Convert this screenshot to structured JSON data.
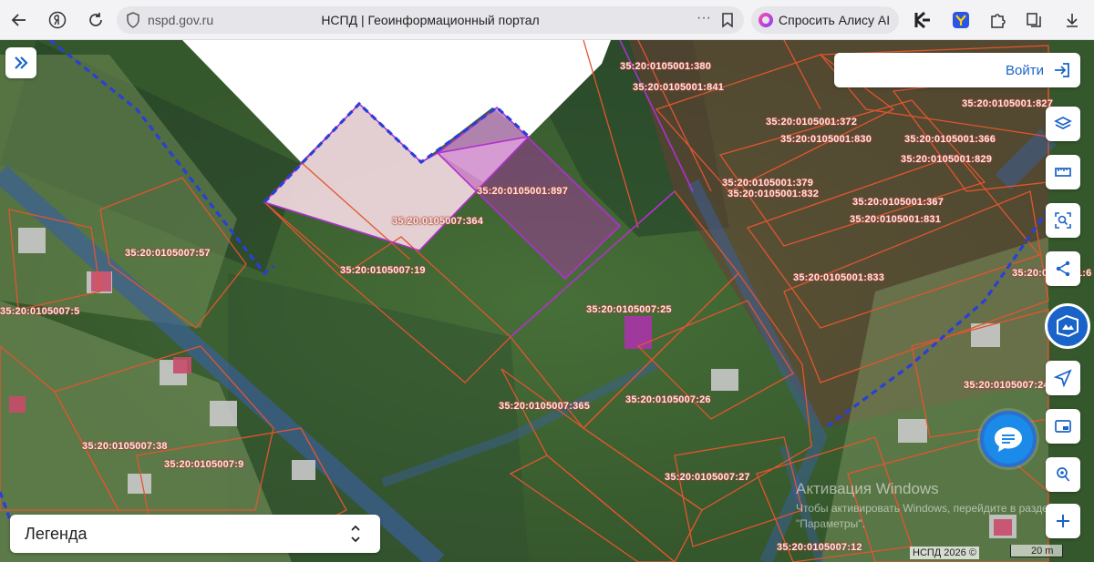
{
  "browser": {
    "url": "nspd.gov.ru",
    "page_title": "НСПД | Геоинформационный портал",
    "menu_dots": "···",
    "alice_label": "Спросить Алису AI"
  },
  "map": {
    "login_label": "Войти",
    "legend_label": "Легенда",
    "copyright": "НСПД 2026 ©",
    "scale_label": "20 m",
    "watermark_title": "Активация Windows",
    "watermark_text": "Чтобы активировать Windows, перейдите в раздел \"Параметры\".",
    "parcels": [
      {
        "label": "35:20:0105001:380"
      },
      {
        "label": "35:20:0105001:841"
      },
      {
        "label": "35:20:0105001:827"
      },
      {
        "label": "35:20:0105001:372"
      },
      {
        "label": "35:20:0105001:830"
      },
      {
        "label": "35:20:0105001:366"
      },
      {
        "label": "35:20:0105001:829"
      },
      {
        "label": "35:20:0105001:379"
      },
      {
        "label": "35:20:0105001:832"
      },
      {
        "label": "35:20:0105001:367"
      },
      {
        "label": "35:20:0105001:831"
      },
      {
        "label": "35:20:0105001:833"
      },
      {
        "label": "35:20:0105001:897"
      },
      {
        "label": "35:20:0105007:364"
      },
      {
        "label": "35:20:0105007:19"
      },
      {
        "label": "35:20:0105007:57"
      },
      {
        "label": "35:20:0105007:25"
      },
      {
        "label": "35:20:0105007:365"
      },
      {
        "label": "35:20:0105007:26"
      },
      {
        "label": "35:20:0105007:38"
      },
      {
        "label": "35:20:0105007:9"
      },
      {
        "label": "35:20:0105007:27"
      },
      {
        "label": "35:20:0105007:24"
      },
      {
        "label": "35:20:0105007:12"
      },
      {
        "label": "35:20:0105001:6"
      },
      {
        "label": "35:20:0105007:5"
      }
    ]
  },
  "colors": {
    "accent": "#1a63c8",
    "parcel_border": "#e2552f",
    "boundary_dashed": "#2a3fd8",
    "selected_parcel": "#b030b0"
  }
}
